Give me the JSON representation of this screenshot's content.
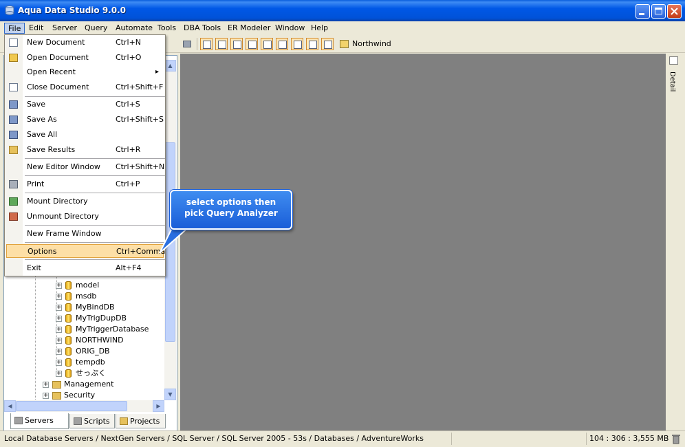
{
  "window": {
    "title": "Aqua Data Studio 9.0.0"
  },
  "menubar": {
    "items": [
      "File",
      "Edit",
      "Server",
      "Query",
      "Automate",
      "Tools",
      "DBA Tools",
      "ER Modeler",
      "Window",
      "Help"
    ],
    "active": "File"
  },
  "toolbar": {
    "connection_label": "Northwind"
  },
  "file_menu": {
    "items": [
      {
        "label": "New Document",
        "shortcut": "Ctrl+N",
        "icon": "new-document-icon"
      },
      {
        "label": "Open Document",
        "shortcut": "Ctrl+O",
        "icon": "folder-open-icon"
      },
      {
        "label": "Open Recent",
        "shortcut": "",
        "submenu_arrow": "▸"
      },
      {
        "label": "Close Document",
        "shortcut": "Ctrl+Shift+F",
        "icon": "close-document-icon"
      },
      {
        "label": "Save",
        "shortcut": "Ctrl+S",
        "icon": "save-icon"
      },
      {
        "label": "Save As",
        "shortcut": "Ctrl+Shift+S",
        "icon": "save-as-icon"
      },
      {
        "label": "Save All",
        "shortcut": "",
        "icon": "save-all-icon"
      },
      {
        "label": "Save Results",
        "shortcut": "Ctrl+R",
        "icon": "save-results-icon"
      },
      {
        "label": "New Editor Window",
        "shortcut": "Ctrl+Shift+N"
      },
      {
        "label": "Print",
        "shortcut": "Ctrl+P",
        "icon": "print-icon"
      },
      {
        "label": "Mount Directory",
        "shortcut": "",
        "icon": "mount-directory-icon"
      },
      {
        "label": "Unmount Directory",
        "shortcut": "",
        "icon": "unmount-directory-icon"
      },
      {
        "label": "New Frame Window",
        "shortcut": ""
      },
      {
        "label": "Options",
        "shortcut": "Ctrl+Comma",
        "highlighted": true
      },
      {
        "label": "Exit",
        "shortcut": "Alt+F4"
      }
    ]
  },
  "callout": {
    "line1": "select options then",
    "line2": "pick Query Analyzer"
  },
  "tree": {
    "databases": [
      "model",
      "msdb",
      "MyBindDB",
      "MyTrigDupDB",
      "MyTriggerDatabase",
      "NORTHWIND",
      "ORIG_DB",
      "tempdb",
      "せっぷく"
    ],
    "folders": [
      "Management",
      "Security"
    ]
  },
  "bottom_tabs": [
    "Servers",
    "Scripts",
    "Projects"
  ],
  "right_panel": {
    "tab_label": "Detail"
  },
  "statusbar": {
    "path": "Local Database Servers / NextGen Servers / SQL Server / SQL Server 2005 - 53s / Databases / AdventureWorks",
    "memory": "104 : 306 : 3,555 MB"
  },
  "colors": {
    "titlebar": "#0054E3",
    "workspace": "#808080",
    "menu_highlight": "#FDDFA6",
    "callout": "#2A6FE0"
  }
}
